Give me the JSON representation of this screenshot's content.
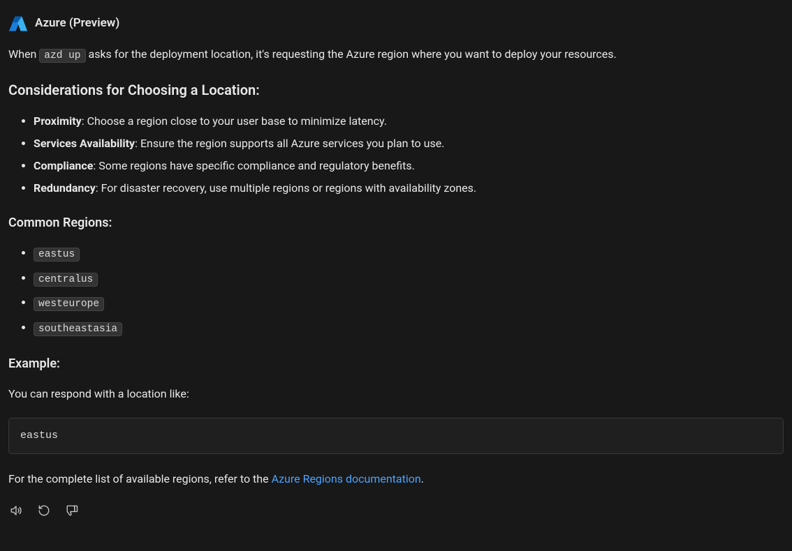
{
  "header": {
    "title": "Azure (Preview)"
  },
  "intro": {
    "prefix": "When ",
    "code": "azd up",
    "suffix": " asks for the deployment location, it's requesting the Azure region where you want to deploy your resources."
  },
  "sections": {
    "considerations": {
      "heading": "Considerations for Choosing a Location:",
      "items": [
        {
          "label": "Proximity",
          "text": ": Choose a region close to your user base to minimize latency."
        },
        {
          "label": "Services Availability",
          "text": ": Ensure the region supports all Azure services you plan to use."
        },
        {
          "label": "Compliance",
          "text": ": Some regions have specific compliance and regulatory benefits."
        },
        {
          "label": "Redundancy",
          "text": ": For disaster recovery, use multiple regions or regions with availability zones."
        }
      ]
    },
    "common_regions": {
      "heading": "Common Regions:",
      "items": [
        "eastus",
        "centralus",
        "westeurope",
        "southeastasia"
      ]
    },
    "example": {
      "heading": "Example:",
      "intro": "You can respond with a location like:",
      "code": "eastus"
    },
    "footer": {
      "prefix": "For the complete list of available regions, refer to the ",
      "link_text": "Azure Regions documentation",
      "suffix": "."
    }
  },
  "actions": {
    "speaker": "speaker-icon",
    "retry": "retry-icon",
    "dislike": "thumbs-down-icon"
  }
}
